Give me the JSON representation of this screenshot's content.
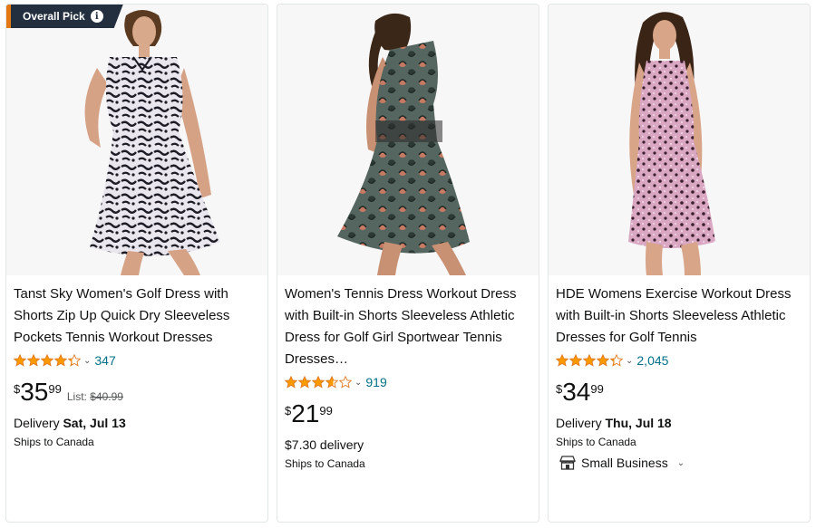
{
  "badge": {
    "label": "Overall Pick",
    "info_icon": "info-icon"
  },
  "products": [
    {
      "title": "Tanst Sky Women's Golf Dress with Shorts Zip Up Quick Dry Sleeveless Pockets Tennis Workout Dresses",
      "rating": 4.3,
      "rating_count": "347",
      "price_symbol": "$",
      "price_whole": "35",
      "price_fraction": "99",
      "list_label": "List:",
      "list_price": "$40.99",
      "delivery_label": "Delivery",
      "delivery_date": "Sat, Jul 13",
      "ships": "Ships to Canada"
    },
    {
      "title": "Women's Tennis Dress Workout Dress with Built-in Shorts Sleeveless Athletic Dress for Golf Girl Sportwear Tennis Dresses…",
      "rating": 3.6,
      "rating_count": "919",
      "price_symbol": "$",
      "price_whole": "21",
      "price_fraction": "99",
      "delivery_cost": "$7.30 delivery",
      "ships": "Ships to Canada"
    },
    {
      "title": "HDE Womens Exercise Workout Dress with Built-in Shorts Sleeveless Athletic Dresses for Golf Tennis",
      "rating": 4.3,
      "rating_count": "2,045",
      "price_symbol": "$",
      "price_whole": "34",
      "price_fraction": "99",
      "delivery_label": "Delivery",
      "delivery_date": "Thu, Jul 18",
      "ships": "Ships to Canada",
      "small_business": "Small Business"
    }
  ],
  "colors": {
    "link": "#007185",
    "star": "#ff9900",
    "badge_bg": "#232f3e",
    "badge_accent": "#e47911"
  }
}
